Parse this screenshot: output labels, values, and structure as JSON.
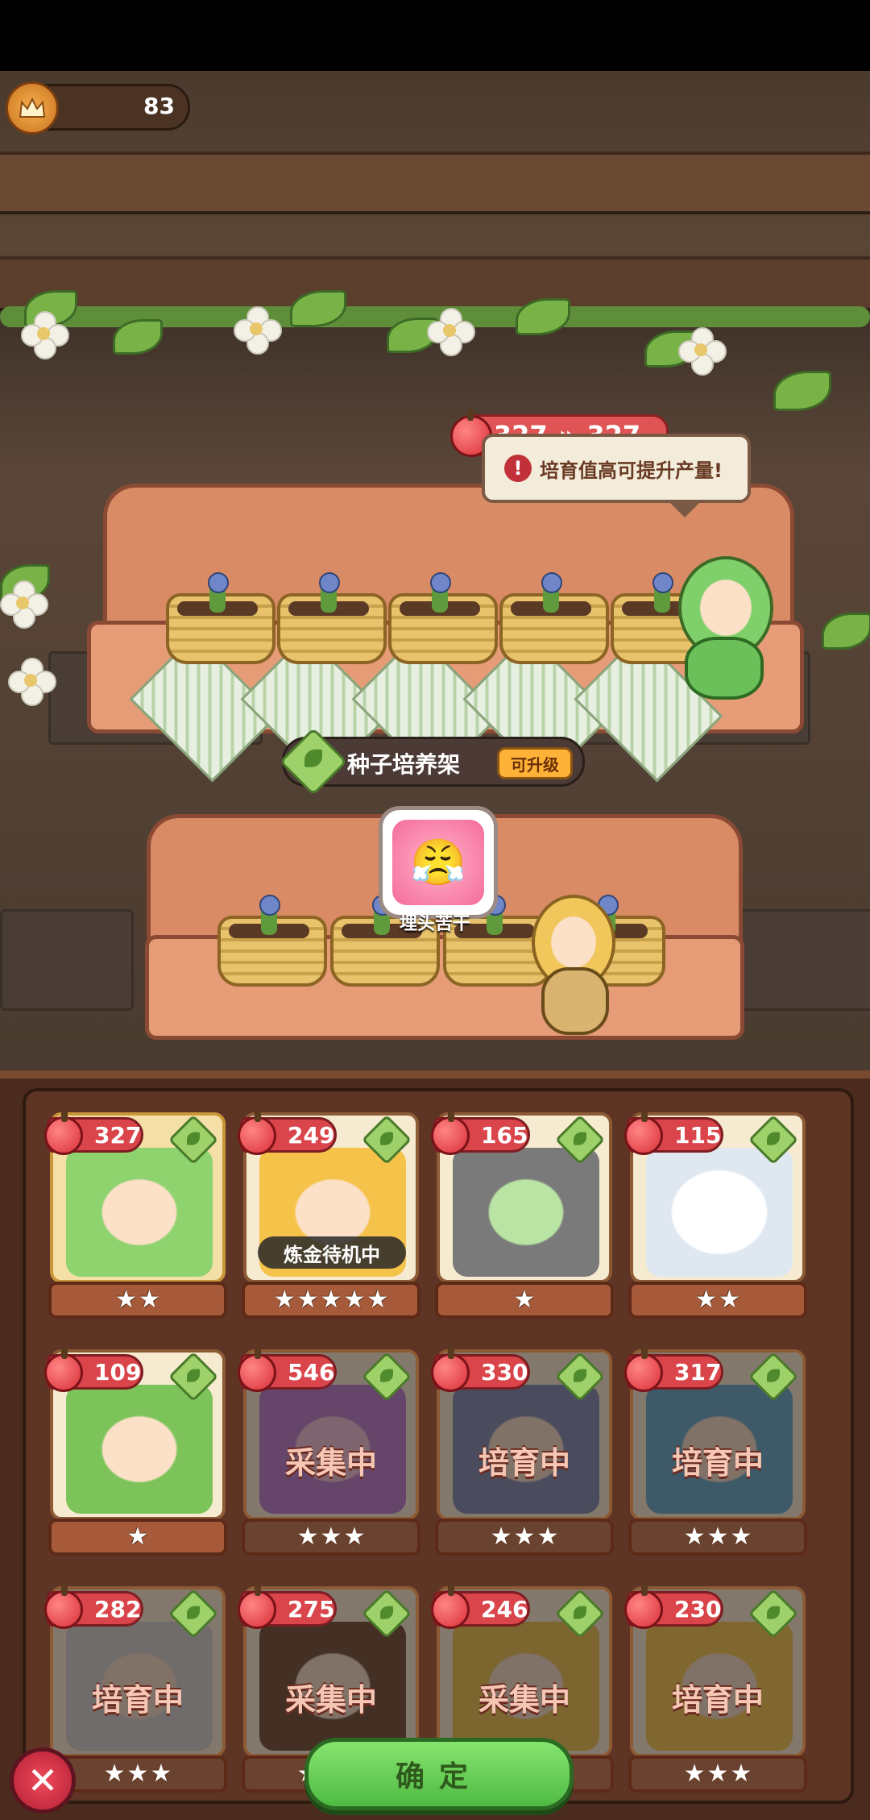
{
  "currency": {
    "value": "83",
    "icon": "crown-icon"
  },
  "growth": {
    "current": "327",
    "next": "327",
    "arrow": "»",
    "tip": "培育值高可提升产量!"
  },
  "shelf": {
    "name": "种子培养架",
    "upgrade": "可升级"
  },
  "skill": {
    "label": "埋头苦干"
  },
  "cards": [
    {
      "rate": "327",
      "stars": 2,
      "status": "",
      "selected": true
    },
    {
      "rate": "249",
      "stars": 5,
      "status": "炼金待机中",
      "selected": false
    },
    {
      "rate": "165",
      "stars": 1,
      "status": "",
      "selected": false
    },
    {
      "rate": "115",
      "stars": 2,
      "status": "",
      "selected": false
    },
    {
      "rate": "109",
      "stars": 1,
      "status": "",
      "selected": false
    },
    {
      "rate": "546",
      "stars": 3,
      "status": "采集中",
      "busy": true
    },
    {
      "rate": "330",
      "stars": 3,
      "status": "培育中",
      "busy": true
    },
    {
      "rate": "317",
      "stars": 3,
      "status": "培育中",
      "busy": true
    },
    {
      "rate": "282",
      "stars": 3,
      "status": "培育中",
      "busy": true
    },
    {
      "rate": "275",
      "stars": 3,
      "status": "采集中",
      "busy": true
    },
    {
      "rate": "246",
      "stars": 3,
      "status": "采集中",
      "busy": true
    },
    {
      "rate": "230",
      "stars": 3,
      "status": "培育中",
      "busy": true
    }
  ],
  "confirm_label": "确定",
  "close_label": "✕",
  "colors": {
    "accent_red": "#d9454a",
    "confirm_green": "#4fbb43",
    "panel_brown": "#5e3524"
  }
}
